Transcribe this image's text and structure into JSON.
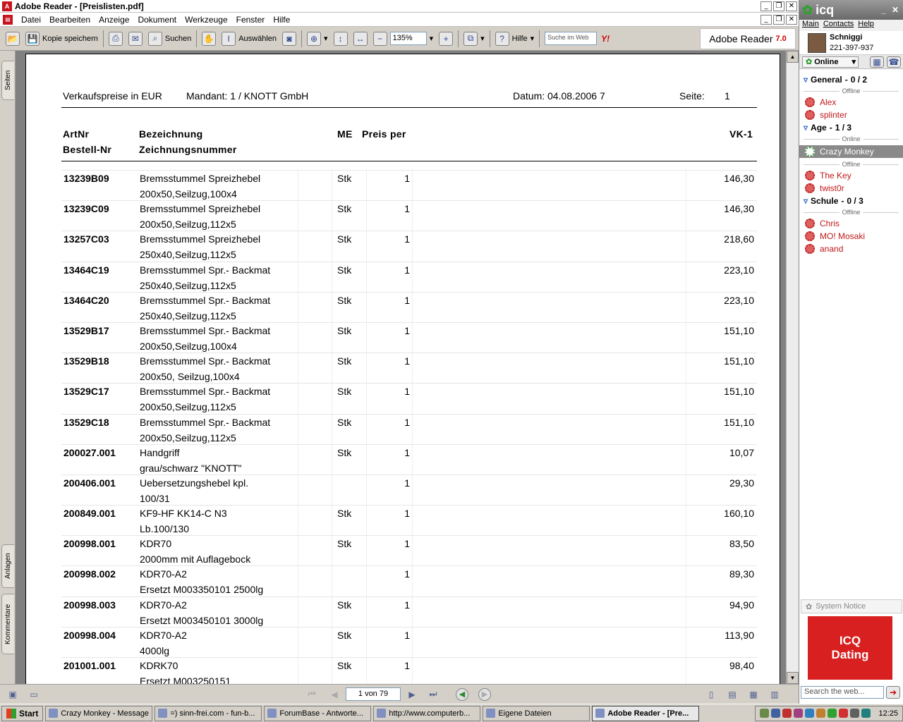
{
  "window": {
    "title": "Adobe Reader - [Preislisten.pdf]"
  },
  "menu": [
    "Datei",
    "Bearbeiten",
    "Anzeige",
    "Dokument",
    "Werkzeuge",
    "Fenster",
    "Hilfe"
  ],
  "toolbar": {
    "save_copy": "Kopie speichern",
    "search": "Suchen",
    "select": "Auswählen",
    "zoom": "135%",
    "help": "Hilfe",
    "web_search_placeholder": "Suche im Web",
    "brand": "Adobe Reader",
    "version": "7.0"
  },
  "side_tabs": [
    "Seiten",
    "Anlagen",
    "Kommentare"
  ],
  "document": {
    "header": {
      "title": "Verkaufspreise in EUR",
      "mandant": "Mandant: 1 / KNOTT GmbH",
      "datum": "Datum: 04.08.2006  7",
      "seite_label": "Seite:",
      "seite_value": "1"
    },
    "columns": {
      "artnr": "ArtNr",
      "bestell": "Bestell-Nr",
      "bezeichnung": "Bezeichnung",
      "zeichnung": "Zeichnungsnummer",
      "me": "ME",
      "preis": "Preis per",
      "vk": "VK-1"
    },
    "rows": [
      {
        "art": "13239B09",
        "d1": "Bremsstummel Spreizhebel",
        "d2": "200x50,Seilzug,100x4",
        "me": "Stk",
        "qty": "1",
        "vk": "146,30"
      },
      {
        "art": "13239C09",
        "d1": "Bremsstummel Spreizhebel",
        "d2": "200x50,Seilzug,112x5",
        "me": "Stk",
        "qty": "1",
        "vk": "146,30"
      },
      {
        "art": "13257C03",
        "d1": "Bremsstummel Spreizhebel",
        "d2": "250x40,Seilzug,112x5",
        "me": "Stk",
        "qty": "1",
        "vk": "218,60"
      },
      {
        "art": "13464C19",
        "d1": "Bremsstummel Spr.- Backmat",
        "d2": "250x40,Seilzug,112x5",
        "me": "Stk",
        "qty": "1",
        "vk": "223,10"
      },
      {
        "art": "13464C20",
        "d1": "Bremsstummel Spr.- Backmat",
        "d2": "250x40,Seilzug,112x5",
        "me": "Stk",
        "qty": "1",
        "vk": "223,10"
      },
      {
        "art": "13529B17",
        "d1": "Bremsstummel Spr.- Backmat",
        "d2": "200x50,Seilzug,100x4",
        "me": "Stk",
        "qty": "1",
        "vk": "151,10"
      },
      {
        "art": "13529B18",
        "d1": "Bremsstummel Spr.- Backmat",
        "d2": "200x50, Seilzug,100x4",
        "me": "Stk",
        "qty": "1",
        "vk": "151,10"
      },
      {
        "art": "13529C17",
        "d1": "Bremsstummel Spr.- Backmat",
        "d2": "200x50,Seilzug,112x5",
        "me": "Stk",
        "qty": "1",
        "vk": "151,10"
      },
      {
        "art": "13529C18",
        "d1": "Bremsstummel Spr.- Backmat",
        "d2": "200x50,Seilzug,112x5",
        "me": "Stk",
        "qty": "1",
        "vk": "151,10"
      },
      {
        "art": "200027.001",
        "d1": "Handgriff",
        "d2": "grau/schwarz \"KNOTT\"",
        "me": "Stk",
        "qty": "1",
        "vk": "10,07"
      },
      {
        "art": "200406.001",
        "d1": "Uebersetzungshebel kpl.",
        "d2": "100/31",
        "me": "",
        "qty": "1",
        "vk": "29,30"
      },
      {
        "art": "200849.001",
        "d1": "KF9-HF KK14-C N3",
        "d2": "Lb.100/130",
        "me": "Stk",
        "qty": "1",
        "vk": "160,10"
      },
      {
        "art": "200998.001",
        "d1": "KDR70",
        "d2": "2000mm mit Auflagebock",
        "me": "Stk",
        "qty": "1",
        "vk": "83,50"
      },
      {
        "art": "200998.002",
        "d1": "KDR70-A2",
        "d2": "Ersetzt M003350101 2500lg",
        "me": "",
        "qty": "1",
        "vk": "89,30"
      },
      {
        "art": "200998.003",
        "d1": "KDR70-A2",
        "d2": "Ersetzt M003450101 3000lg",
        "me": "Stk",
        "qty": "1",
        "vk": "94,90"
      },
      {
        "art": "200998.004",
        "d1": "KDR70-A2",
        "d2": "4000lg",
        "me": "Stk",
        "qty": "1",
        "vk": "113,90"
      },
      {
        "art": "201001.001",
        "d1": "KDRK70",
        "d2": "Ersetzt M003250151",
        "me": "Stk",
        "qty": "1",
        "vk": "98,40"
      }
    ]
  },
  "statusbar": {
    "page": "1 von 79"
  },
  "icq": {
    "title": "icq",
    "menu": [
      "Main",
      "Contacts",
      "Help"
    ],
    "user": {
      "name": "Schniggi",
      "uin": "221-397-937"
    },
    "status": "Online",
    "groups": [
      {
        "name": "General",
        "count": "0 / 2",
        "sections": [
          {
            "label": "Offline",
            "contacts": [
              "Alex",
              "splinter"
            ]
          }
        ]
      },
      {
        "name": "Age",
        "count": "1 / 3",
        "sections": [
          {
            "label": "Online",
            "contacts": [
              "Crazy Monkey"
            ]
          },
          {
            "label": "Offline",
            "contacts": [
              "The Key",
              "twist0r"
            ]
          }
        ]
      },
      {
        "name": "Schule",
        "count": "0 / 3",
        "sections": [
          {
            "label": "Offline",
            "contacts": [
              "Chris",
              "MO! Mosaki",
              "anand"
            ]
          }
        ]
      }
    ],
    "system_notice": "System Notice",
    "ad": {
      "line1": "ICQ",
      "line2": "Dating"
    },
    "search_placeholder": "Search the web..."
  },
  "taskbar": {
    "start": "Start",
    "tasks": [
      "Crazy Monkey - Message",
      "=) sinn-frei.com - fun-b...",
      "ForumBase - Antworte...",
      "http://www.computerb...",
      "Eigene Dateien",
      "Adobe Reader - [Pre..."
    ],
    "clock": "12:25"
  }
}
